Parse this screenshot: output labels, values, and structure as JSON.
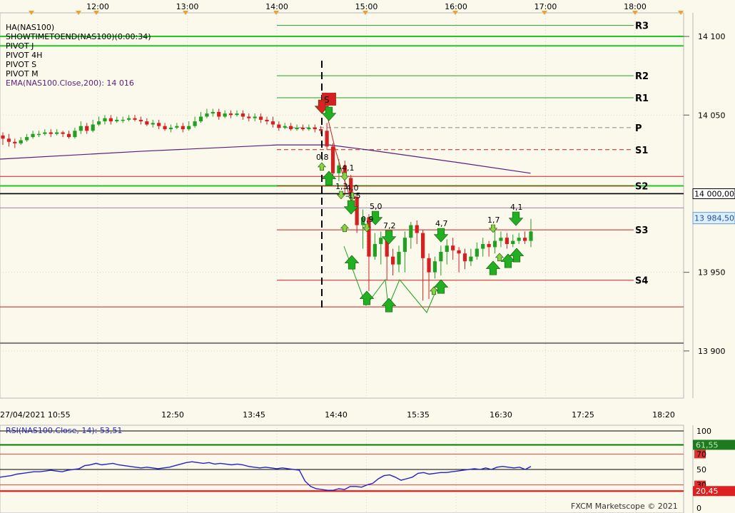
{
  "legend": {
    "instrument": "HA(NAS100)",
    "timer": "SHOWTIMETOEND(NAS100)(0:00:34)",
    "pivot_j": "PIVOT J",
    "pivot_4h": "PIVOT 4H",
    "pivot_s": "PIVOT S",
    "pivot_m": "PIVOT M",
    "ema": "EMA(NAS100.Close,200): 14 016"
  },
  "rsi_legend": "RSI(NAS100.Close, 14): 53,51",
  "copyright": "FXCM Marketscope © 2021",
  "colors": {
    "background": "#FBF9EC",
    "up_candle": "#22A022",
    "down_candle": "#D42020",
    "ema": "#5A1E7A",
    "rsi": "#2323C8",
    "pivot_line": "#22A022",
    "support_line": "#C81E1E"
  },
  "chart_data": {
    "type": "candlestick",
    "price_axis": {
      "min": 13870,
      "max": 14115,
      "ticks": [
        "14 100",
        "14 050",
        "13 950",
        "13 900"
      ]
    },
    "top_time_labels": [
      "12:00",
      "13:00",
      "14:00",
      "15:00",
      "16:00",
      "17:00",
      "18:00"
    ],
    "bottom_time_labels": [
      "27/04/2021 10:55",
      "12:50",
      "13:45",
      "14:40",
      "15:35",
      "16:30",
      "17:25",
      "18:20"
    ],
    "last_price": "13 984,50",
    "level_label": "14 000,00",
    "pivot_levels": [
      {
        "name": "R3",
        "value": 14107
      },
      {
        "name": "R2",
        "value": 14075
      },
      {
        "name": "R1",
        "value": 14061
      },
      {
        "name": "P",
        "value": 14042
      },
      {
        "name": "S1",
        "value": 14028
      },
      {
        "name": "S2",
        "value": 14005
      },
      {
        "name": "S3",
        "value": 13977
      },
      {
        "name": "S4",
        "value": 13945
      }
    ],
    "extra_levels": [
      {
        "kind": "thick-green",
        "value": 14100
      },
      {
        "kind": "thick-green",
        "value": 14094
      },
      {
        "kind": "thick-green",
        "value": 14005
      },
      {
        "kind": "black",
        "value": 14000
      },
      {
        "kind": "red",
        "value": 14011
      },
      {
        "kind": "red",
        "value": 13928
      },
      {
        "kind": "gray",
        "value": 13905
      },
      {
        "kind": "purple-thin",
        "value": 13991
      }
    ],
    "ema": [
      {
        "t": "10:55",
        "v": 14022
      },
      {
        "t": "12:30",
        "v": 14027
      },
      {
        "t": "14:00",
        "v": 14031
      },
      {
        "t": "14:35",
        "v": 14031
      },
      {
        "t": "15:00",
        "v": 14028
      },
      {
        "t": "16:00",
        "v": 14020
      },
      {
        "t": "16:50",
        "v": 14013
      }
    ],
    "candles": [
      {
        "o": 14037,
        "c": 14035,
        "h": 14039,
        "l": 14031
      },
      {
        "o": 14035,
        "c": 14033,
        "h": 14038,
        "l": 14030
      },
      {
        "o": 14033,
        "c": 14032,
        "h": 14035,
        "l": 14029
      },
      {
        "o": 14032,
        "c": 14034,
        "h": 14036,
        "l": 14031
      },
      {
        "o": 14034,
        "c": 14036,
        "h": 14038,
        "l": 14033
      },
      {
        "o": 14036,
        "c": 14038,
        "h": 14040,
        "l": 14035
      },
      {
        "o": 14038,
        "c": 14038,
        "h": 14040,
        "l": 14036
      },
      {
        "o": 14038,
        "c": 14039,
        "h": 14041,
        "l": 14037
      },
      {
        "o": 14039,
        "c": 14038,
        "h": 14041,
        "l": 14036
      },
      {
        "o": 14038,
        "c": 14039,
        "h": 14041,
        "l": 14037
      },
      {
        "o": 14039,
        "c": 14038,
        "h": 14040,
        "l": 14036
      },
      {
        "o": 14038,
        "c": 14036,
        "h": 14040,
        "l": 14035
      },
      {
        "o": 14036,
        "c": 14040,
        "h": 14042,
        "l": 14035
      },
      {
        "o": 14040,
        "c": 14043,
        "h": 14046,
        "l": 14038
      },
      {
        "o": 14043,
        "c": 14040,
        "h": 14045,
        "l": 14038
      },
      {
        "o": 14040,
        "c": 14044,
        "h": 14047,
        "l": 14039
      },
      {
        "o": 14044,
        "c": 14046,
        "h": 14049,
        "l": 14043
      },
      {
        "o": 14046,
        "c": 14048,
        "h": 14050,
        "l": 14044
      },
      {
        "o": 14048,
        "c": 14046,
        "h": 14050,
        "l": 14044
      },
      {
        "o": 14046,
        "c": 14047,
        "h": 14049,
        "l": 14045
      },
      {
        "o": 14047,
        "c": 14047,
        "h": 14049,
        "l": 14045
      },
      {
        "o": 14047,
        "c": 14048,
        "h": 14050,
        "l": 14046
      },
      {
        "o": 14048,
        "c": 14047,
        "h": 14050,
        "l": 14046
      },
      {
        "o": 14047,
        "c": 14046,
        "h": 14049,
        "l": 14044
      },
      {
        "o": 14046,
        "c": 14044,
        "h": 14048,
        "l": 14043
      },
      {
        "o": 14044,
        "c": 14045,
        "h": 14047,
        "l": 14042
      },
      {
        "o": 14045,
        "c": 14043,
        "h": 14047,
        "l": 14041
      },
      {
        "o": 14043,
        "c": 14041,
        "h": 14045,
        "l": 14040
      },
      {
        "o": 14041,
        "c": 14042,
        "h": 14044,
        "l": 14039
      },
      {
        "o": 14042,
        "c": 14043,
        "h": 14045,
        "l": 14041
      },
      {
        "o": 14043,
        "c": 14041,
        "h": 14045,
        "l": 14039
      },
      {
        "o": 14041,
        "c": 14043,
        "h": 14046,
        "l": 14040
      },
      {
        "o": 14043,
        "c": 14046,
        "h": 14049,
        "l": 14042
      },
      {
        "o": 14046,
        "c": 14049,
        "h": 14052,
        "l": 14045
      },
      {
        "o": 14049,
        "c": 14051,
        "h": 14054,
        "l": 14048
      },
      {
        "o": 14051,
        "c": 14052,
        "h": 14054,
        "l": 14049
      },
      {
        "o": 14052,
        "c": 14049,
        "h": 14054,
        "l": 14047
      },
      {
        "o": 14049,
        "c": 14051,
        "h": 14053,
        "l": 14048
      },
      {
        "o": 14051,
        "c": 14050,
        "h": 14053,
        "l": 14048
      },
      {
        "o": 14050,
        "c": 14051,
        "h": 14053,
        "l": 14049
      },
      {
        "o": 14051,
        "c": 14049,
        "h": 14053,
        "l": 14047
      },
      {
        "o": 14049,
        "c": 14048,
        "h": 14051,
        "l": 14046
      },
      {
        "o": 14048,
        "c": 14049,
        "h": 14051,
        "l": 14046
      },
      {
        "o": 14049,
        "c": 14047,
        "h": 14051,
        "l": 14045
      },
      {
        "o": 14047,
        "c": 14046,
        "h": 14049,
        "l": 14044
      },
      {
        "o": 14046,
        "c": 14044,
        "h": 14049,
        "l": 14042
      },
      {
        "o": 14044,
        "c": 14042,
        "h": 14046,
        "l": 14040
      },
      {
        "o": 14042,
        "c": 14043,
        "h": 14045,
        "l": 14041
      },
      {
        "o": 14043,
        "c": 14041,
        "h": 14045,
        "l": 14040
      },
      {
        "o": 14041,
        "c": 14042,
        "h": 14044,
        "l": 14040
      },
      {
        "o": 14042,
        "c": 14041,
        "h": 14044,
        "l": 14040
      },
      {
        "o": 14041,
        "c": 14042,
        "h": 14044,
        "l": 14040
      },
      {
        "o": 14042,
        "c": 14041,
        "h": 14044,
        "l": 14039
      },
      {
        "o": 14041,
        "c": 14040,
        "h": 14043,
        "l": 14038
      },
      {
        "o": 14040,
        "c": 14030,
        "h": 14045,
        "l": 14028
      },
      {
        "o": 14030,
        "c": 14013,
        "h": 14032,
        "l": 14010
      },
      {
        "o": 14013,
        "c": 14018,
        "h": 14022,
        "l": 14008
      },
      {
        "o": 14018,
        "c": 14010,
        "h": 14021,
        "l": 14000
      },
      {
        "o": 14010,
        "c": 13998,
        "h": 14012,
        "l": 13992
      },
      {
        "o": 13998,
        "c": 13980,
        "h": 14000,
        "l": 13975
      },
      {
        "o": 13980,
        "c": 13985,
        "h": 13990,
        "l": 13965
      },
      {
        "o": 13985,
        "c": 13960,
        "h": 13987,
        "l": 13938
      },
      {
        "o": 13960,
        "c": 13968,
        "h": 13975,
        "l": 13958
      },
      {
        "o": 13968,
        "c": 13972,
        "h": 13976,
        "l": 13955
      },
      {
        "o": 13972,
        "c": 13960,
        "h": 13974,
        "l": 13945
      },
      {
        "o": 13960,
        "c": 13955,
        "h": 13965,
        "l": 13948
      },
      {
        "o": 13955,
        "c": 13963,
        "h": 13967,
        "l": 13950
      },
      {
        "o": 13963,
        "c": 13972,
        "h": 13976,
        "l": 13950
      },
      {
        "o": 13972,
        "c": 13980,
        "h": 13982,
        "l": 13965
      },
      {
        "o": 13980,
        "c": 13975,
        "h": 13983,
        "l": 13968
      },
      {
        "o": 13975,
        "c": 13959,
        "h": 13977,
        "l": 13932
      },
      {
        "o": 13959,
        "c": 13950,
        "h": 13962,
        "l": 13933
      },
      {
        "o": 13950,
        "c": 13957,
        "h": 13960,
        "l": 13946
      },
      {
        "o": 13957,
        "c": 13963,
        "h": 13967,
        "l": 13948
      },
      {
        "o": 13963,
        "c": 13967,
        "h": 13971,
        "l": 13955
      },
      {
        "o": 13967,
        "c": 13964,
        "h": 13972,
        "l": 13958
      },
      {
        "o": 13964,
        "c": 13962,
        "h": 13966,
        "l": 13950
      },
      {
        "o": 13962,
        "c": 13957,
        "h": 13965,
        "l": 13952
      },
      {
        "o": 13957,
        "c": 13960,
        "h": 13965,
        "l": 13954
      },
      {
        "o": 13960,
        "c": 13965,
        "h": 13969,
        "l": 13958
      },
      {
        "o": 13965,
        "c": 13968,
        "h": 13972,
        "l": 13960
      },
      {
        "o": 13968,
        "c": 13966,
        "h": 13970,
        "l": 13960
      },
      {
        "o": 13966,
        "c": 13970,
        "h": 13977,
        "l": 13962
      },
      {
        "o": 13970,
        "c": 13972,
        "h": 13976,
        "l": 13966
      },
      {
        "o": 13972,
        "c": 13968,
        "h": 13975,
        "l": 13965
      },
      {
        "o": 13968,
        "c": 13970,
        "h": 13974,
        "l": 13966
      },
      {
        "o": 13970,
        "c": 13972,
        "h": 13975,
        "l": 13968
      },
      {
        "o": 13972,
        "c": 13970,
        "h": 13976,
        "l": 13968
      },
      {
        "o": 13970,
        "c": 13976,
        "h": 13984,
        "l": 13966
      }
    ],
    "signals": [
      {
        "i": 0,
        "type": "sell-red",
        "label": ""
      },
      {
        "i": 1,
        "type": "sell",
        "label": ""
      },
      {
        "i": 2,
        "type": "buy-small",
        "label": "0,8"
      },
      {
        "i": 3,
        "type": "buy",
        "label": ""
      },
      {
        "i": 4,
        "type": "sell-small",
        "label": "-4,1"
      },
      {
        "i": 5,
        "type": "sell-small",
        "label": "1,3"
      },
      {
        "i": 6,
        "type": "sell-small",
        "label": "4,0"
      },
      {
        "i": 7,
        "type": "sell",
        "label": "-1,5"
      },
      {
        "i": 8,
        "type": "buy-small",
        "label": ""
      },
      {
        "i": 9,
        "type": "sell",
        "label": "5,0"
      },
      {
        "i": 10,
        "type": "sell-small",
        "label": "0,9"
      },
      {
        "i": 11,
        "type": "buy",
        "label": ""
      },
      {
        "i": 12,
        "type": "sell",
        "label": "7,2"
      },
      {
        "i": 13,
        "type": "buy",
        "label": ""
      },
      {
        "i": 14,
        "type": "buy",
        "label": ""
      },
      {
        "i": 15,
        "type": "sell",
        "label": "4,7"
      },
      {
        "i": 16,
        "type": "buy",
        "label": ""
      },
      {
        "i": 17,
        "type": "buy-small",
        "label": ""
      },
      {
        "i": 18,
        "type": "sell-small",
        "label": "1,7"
      },
      {
        "i": 19,
        "type": "sell",
        "label": "4,1"
      },
      {
        "i": 20,
        "type": "buy",
        "label": ""
      },
      {
        "i": 21,
        "type": "buy",
        "label": ""
      },
      {
        "i": 22,
        "type": "buy",
        "label": ""
      },
      {
        "i": 23,
        "type": "buy-small",
        "label": ""
      }
    ],
    "rsi_axis": {
      "ticks": [
        "100",
        "70",
        "50",
        "30",
        "0"
      ]
    },
    "rsi_labels": {
      "upper": "61,55",
      "lower": "20,45"
    },
    "rsi": [
      40,
      41,
      42,
      44,
      45,
      46,
      47,
      47,
      48,
      49,
      48,
      47,
      49,
      50,
      51,
      55,
      56,
      58,
      56,
      57,
      58,
      56,
      55,
      54,
      53,
      52,
      53,
      52,
      51,
      52,
      53,
      55,
      57,
      59,
      60,
      59,
      58,
      59,
      57,
      58,
      57,
      56,
      57,
      56,
      54,
      53,
      52,
      53,
      52,
      51,
      52,
      51,
      50,
      49,
      35,
      28,
      25,
      24,
      23,
      23,
      25,
      24,
      28,
      28,
      27,
      30,
      32,
      38,
      42,
      43,
      40,
      36,
      38,
      40,
      45,
      46,
      44,
      45,
      46,
      46,
      47,
      48,
      49,
      50,
      51,
      50,
      52,
      50,
      53,
      54,
      53,
      52,
      53,
      50,
      54
    ]
  }
}
